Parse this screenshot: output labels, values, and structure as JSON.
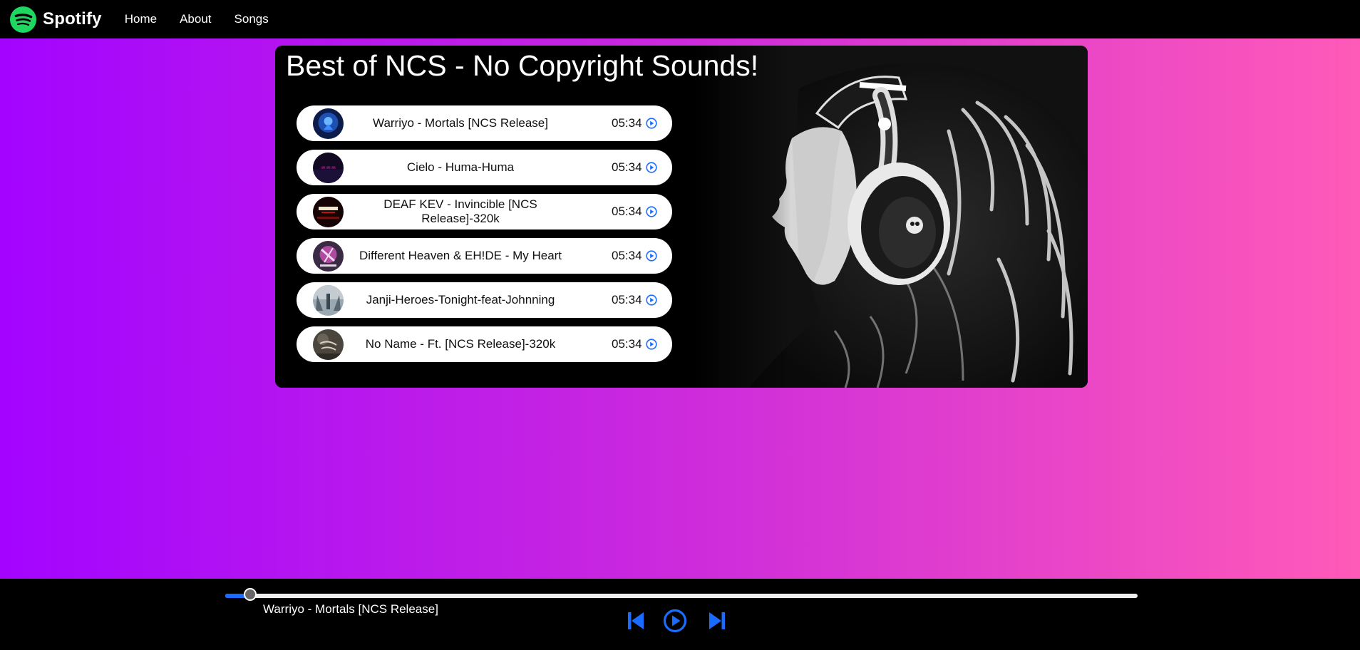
{
  "navbar": {
    "brand": "Spotify",
    "links": [
      "Home",
      "About",
      "Songs"
    ]
  },
  "main": {
    "title": "Best of NCS - No Copyright Sounds!",
    "songs": [
      {
        "name": "Warriyo - Mortals [NCS Release]",
        "duration": "05:34",
        "cover_color": "#1e4fb3"
      },
      {
        "name": "Cielo - Huma-Huma",
        "duration": "05:34",
        "cover_color": "#3a1e5c"
      },
      {
        "name": "DEAF KEV - Invincible [NCS Release]-320k",
        "duration": "05:34",
        "cover_color": "#2a0808"
      },
      {
        "name": "Different Heaven & EH!DE - My Heart",
        "duration": "05:34",
        "cover_color": "#5a2a6a"
      },
      {
        "name": "Janji-Heroes-Tonight-feat-Johnning",
        "duration": "05:34",
        "cover_color": "#8a9aa8"
      },
      {
        "name": "No Name - Ft. [NCS Release]-320k",
        "duration": "05:34",
        "cover_color": "#5a5448"
      }
    ]
  },
  "player": {
    "now_playing": "Warriyo - Mortals [NCS Release]",
    "progress_fraction": 0.027
  },
  "colors": {
    "accent": "#1a6bff",
    "brand_green": "#1ed760",
    "gradient_start": "#a304ff",
    "gradient_end": "#ff5ab8"
  },
  "icons": {
    "logo": "spotify-logo-icon",
    "song_play": "play-circle-icon",
    "previous": "skip-previous-icon",
    "play": "play-circle-icon",
    "next": "skip-next-icon"
  }
}
